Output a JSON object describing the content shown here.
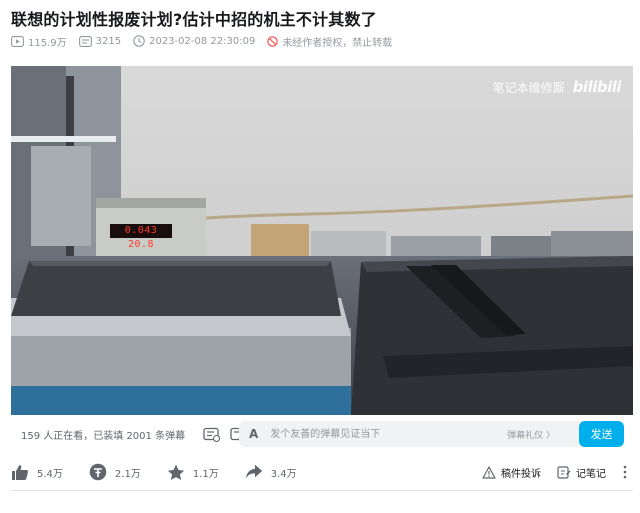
{
  "video": {
    "title": "联想的计划性报废计划?估计中招的机主不计其数了",
    "views": "115.9万",
    "danmaku_total": "3215",
    "pubdate": "2023-02-08 22:30:09",
    "copyright": "未经作者授权，禁止转载"
  },
  "player": {
    "watermark_text": "笔记本维修厮",
    "watermark_logo": "bilibili",
    "lcd_reading": "0.043 20.8"
  },
  "danmaku_bar": {
    "status": "159 人正在看，已装填 2001 条弹幕",
    "input_placeholder": "发个友善的弹幕见证当下",
    "etiquette": "弹幕礼仪 〉",
    "send_label": "发送"
  },
  "toolbar": {
    "like": "5.4万",
    "coin": "2.1万",
    "favorite": "1.1万",
    "share": "3.4万",
    "report": "稿件投诉",
    "note": "记笔记"
  },
  "colors": {
    "accent": "#00aeec",
    "muted_text": "#9499a0",
    "icon": "#61666d"
  }
}
